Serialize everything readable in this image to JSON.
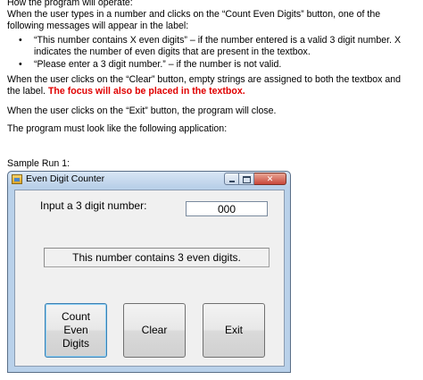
{
  "document": {
    "heading": "How the program will operate:",
    "intro": "When the user types in a number and clicks on the “Count Even Digits” button, one of the following messages will appear in the label:",
    "bullets": [
      "“This number contains X even digits” – if the number entered is a valid 3 digit number. X indicates the number of even digits that are present in the textbox.",
      "“Please enter a 3 digit number.” – if the number is not valid."
    ],
    "bullet_symbol": "•",
    "clear_text": "When the user clicks on the “Clear” button, empty strings are assigned to both the textbox and the label.",
    "clear_emphasis": "The focus will also be placed in the textbox.",
    "exit_text": "When the user clicks on the “Exit” button, the program will close.",
    "must_text": "The program must look like the following application:",
    "sample_label": "Sample Run 1:"
  },
  "window": {
    "title": "Even Digit Counter",
    "icon": "app-form-icon",
    "controls": [
      "minimize-icon",
      "maximize-icon",
      "close-icon"
    ]
  },
  "form": {
    "prompt_label": "Input a 3 digit number:",
    "input_value": "000",
    "result_text": "This number contains 3 even digits.",
    "buttons": {
      "count": "Count Even Digits",
      "clear": "Clear",
      "exit": "Exit"
    }
  },
  "colors": {
    "emphasis": "#e00000",
    "window_frame": "#b9d1ea",
    "focused_button_border": "#3c7fb1"
  }
}
